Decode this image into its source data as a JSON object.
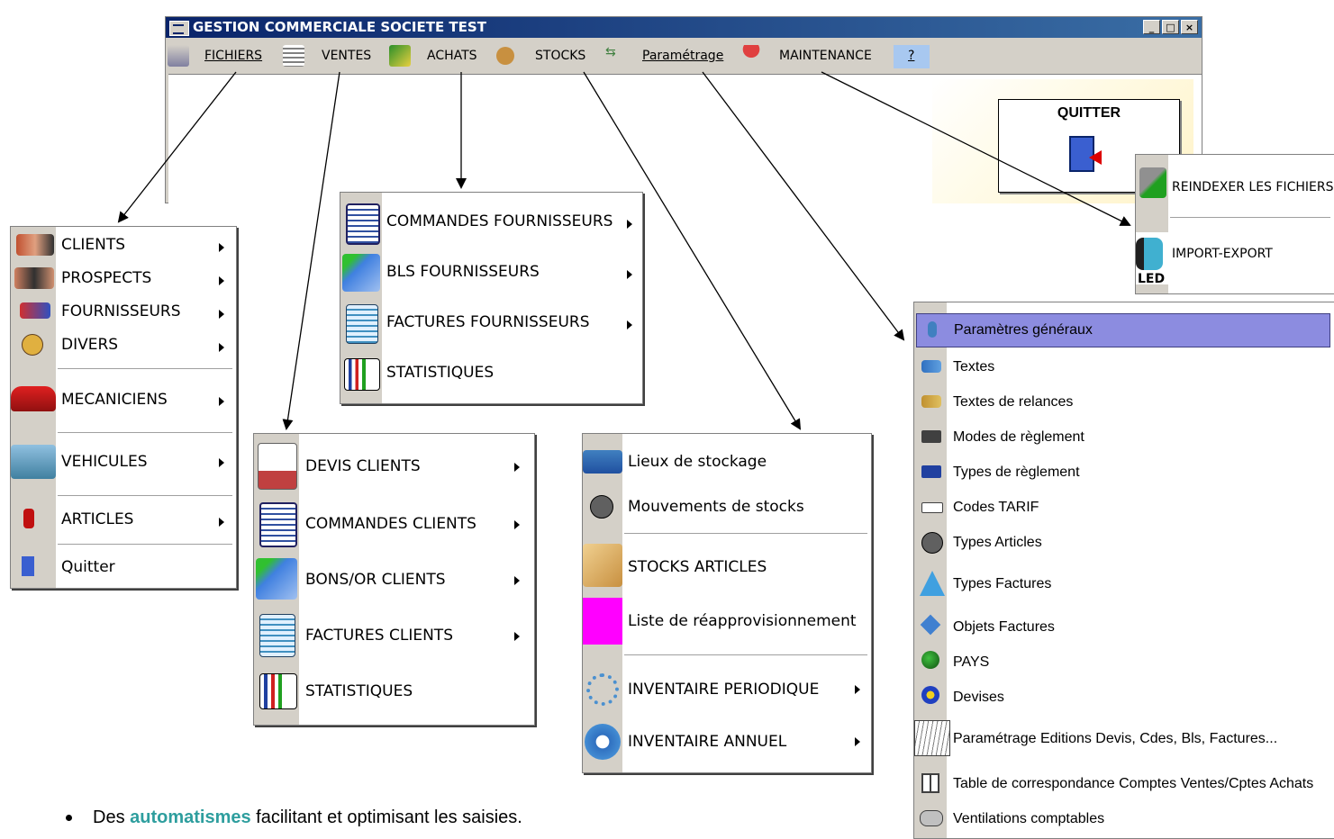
{
  "window": {
    "title": "GESTION COMMERCIALE SOCIETE TEST",
    "controls": [
      "_",
      "□",
      "×"
    ]
  },
  "menubar": [
    {
      "label": "FICHIERS",
      "icon": "building-icon"
    },
    {
      "label": "VENTES",
      "icon": "receipt-icon"
    },
    {
      "label": "ACHATS",
      "icon": "chart-icon"
    },
    {
      "label": "STOCKS",
      "icon": "box-icon"
    },
    {
      "label": "Paramétrage",
      "icon": "arrows-icon"
    },
    {
      "label": "MAINTENANCE",
      "icon": "umbrella-icon"
    },
    {
      "label": "?"
    }
  ],
  "quit_panel": {
    "label": "QUITTER",
    "icon": "door-exit-icon"
  },
  "menus": {
    "fichiers": [
      {
        "label": "CLIENTS",
        "submenu": true
      },
      {
        "label": "PROSPECTS",
        "submenu": true
      },
      {
        "label": "FOURNISSEURS",
        "submenu": true
      },
      {
        "label": "DIVERS",
        "submenu": true
      },
      {
        "label": "MECANICIENS",
        "submenu": true
      },
      {
        "label": "VEHICULES",
        "submenu": true
      },
      {
        "label": "ARTICLES",
        "submenu": true
      },
      {
        "label": "Quitter",
        "submenu": false
      }
    ],
    "achats": [
      {
        "label": "COMMANDES FOURNISSEURS",
        "submenu": true
      },
      {
        "label": "BLS FOURNISSEURS",
        "submenu": true
      },
      {
        "label": "FACTURES FOURNISSEURS",
        "submenu": true
      },
      {
        "label": "STATISTIQUES",
        "submenu": false
      }
    ],
    "ventes": [
      {
        "label": "DEVIS CLIENTS",
        "submenu": true
      },
      {
        "label": "COMMANDES CLIENTS",
        "submenu": true
      },
      {
        "label": "BONS/OR CLIENTS",
        "submenu": true
      },
      {
        "label": "FACTURES CLIENTS",
        "submenu": true
      },
      {
        "label": "STATISTIQUES",
        "submenu": false
      }
    ],
    "stocks": [
      {
        "label": "Lieux de stockage",
        "submenu": false
      },
      {
        "label": "Mouvements de stocks",
        "submenu": false
      },
      {
        "label": "STOCKS ARTICLES",
        "submenu": false
      },
      {
        "label": "Liste de réapprovisionnement",
        "submenu": false
      },
      {
        "label": "INVENTAIRE PERIODIQUE",
        "submenu": true
      },
      {
        "label": "INVENTAIRE ANNUEL",
        "submenu": true
      }
    ],
    "maintenance": [
      {
        "label": "REINDEXER LES FICHIERS"
      },
      {
        "label": "IMPORT-EXPORT"
      }
    ],
    "maintenance_icon_text": "LED",
    "parametrage": [
      {
        "label": "Paramètres généraux",
        "highlighted": true
      },
      {
        "label": "Textes"
      },
      {
        "label": "Textes de relances"
      },
      {
        "label": "Modes de règlement"
      },
      {
        "label": "Types de règlement"
      },
      {
        "label": "Codes TARIF"
      },
      {
        "label": "Types Articles"
      },
      {
        "label": "Types Factures"
      },
      {
        "label": "Objets Factures"
      },
      {
        "label": "PAYS"
      },
      {
        "label": "Devises"
      },
      {
        "label": "Paramétrage Editions Devis, Cdes, Bls, Factures..."
      },
      {
        "label": "Table de correspondance Comptes Ventes/Cptes Achats"
      },
      {
        "label": "Ventilations comptables"
      }
    ]
  },
  "bullet": {
    "prefix": "Des ",
    "keyword": "automatismes",
    "suffix": " facilitant et optimisant les saisies."
  },
  "colors": {
    "titlebar": "#0a246a",
    "menu_bg": "#d4d0c8",
    "highlight": "#8c8ce0",
    "keyword": "#2e9e9e"
  }
}
